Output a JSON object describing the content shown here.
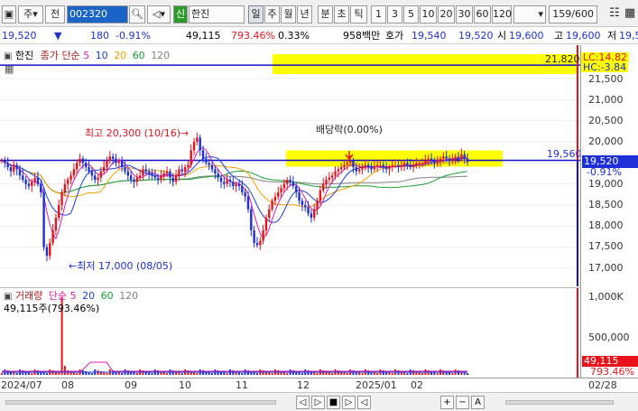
{
  "toolbar": {
    "menu_icon": "window-icon",
    "period_label": "주",
    "compare_label": "전",
    "code_value": "002320",
    "stock_name": "한진",
    "new_label": "신",
    "periods": [
      "일",
      "주",
      "월",
      "년",
      "분",
      "초",
      "틱"
    ],
    "minute_steps": [
      "1",
      "3",
      "5",
      "10",
      "20",
      "30",
      "60",
      "120"
    ],
    "count_value": "159/600"
  },
  "info": {
    "price": "19,520",
    "change": "180",
    "change_pct": "-0.91%",
    "volume": "49,115",
    "volume_ratio": "793.46%",
    "turnover_rate": "0.33%",
    "amount": "958백만",
    "ask_label": "호가",
    "ask_price": "19,540",
    "bid_price": "19,520",
    "open_label": "시",
    "open_price": "19,600",
    "high_label": "고",
    "high_price": "19,600",
    "low_label": "저",
    "low_price": "19,5"
  },
  "price_pane": {
    "name": "한진",
    "indicator": "종가 단순",
    "ma_periods": [
      "5",
      "10",
      "20",
      "60",
      "120"
    ],
    "ma_colors": [
      "#e01ab0",
      "#1a3fd9",
      "#f0a000",
      "#18a030",
      "#808080"
    ],
    "annotation_high": "최고 20,300 (10/16)",
    "annotation_low": "최저 17,000 (08/05)",
    "annotation_dividend": "배당락(0.00%)",
    "line_21820": "21,820",
    "line_19560": "19,560",
    "lc": "LC:14.82",
    "hc": "HC:-3.84",
    "current_price": "19,520",
    "current_pct": "-0.91%"
  },
  "vol_pane": {
    "label": "거래량",
    "indicator": "단순",
    "ma_periods": [
      "5",
      "20",
      "60",
      "120"
    ],
    "value_label": "49,115주(793.46%)",
    "current": "49,115",
    "current_pct": "793.46%"
  },
  "y_ticks": [
    "21,500",
    "21,000",
    "20,500",
    "20,000",
    "19,500",
    "19,000",
    "18,500",
    "18,000",
    "17,500",
    "17,000"
  ],
  "vol_ticks": [
    "1,000K",
    "500,000"
  ],
  "x_ticks": [
    "2024/07",
    "08",
    "09",
    "10",
    "11",
    "12",
    "2025/01",
    "02",
    "02/28"
  ],
  "bottom": {
    "buttons": [
      "◁",
      "▷",
      "■",
      "▷",
      "◁",
      "+",
      "−",
      "A"
    ]
  },
  "colors": {
    "up": "#e8121a",
    "down": "#1d2fd8",
    "highlight": "#ffff00",
    "line_blue": "#1010c8"
  },
  "chart_data": {
    "type": "candlestick",
    "x_range": [
      "2024-07",
      "2025-02-28"
    ],
    "ylim": [
      16800,
      22000
    ],
    "horizontal_lines": [
      21820,
      19560
    ],
    "closes": [
      19550,
      19500,
      19400,
      19300,
      19450,
      19350,
      19200,
      19100,
      19000,
      18950,
      19050,
      19150,
      19000,
      18800,
      17500,
      17300,
      17600,
      17900,
      18200,
      18500,
      18800,
      19000,
      19100,
      19200,
      19350,
      19500,
      19600,
      19500,
      19400,
      19300,
      19200,
      19100,
      19150,
      19300,
      19400,
      19550,
      19650,
      19600,
      19500,
      19550,
      19400,
      19300,
      19200,
      19100,
      19050,
      19150,
      19200,
      19350,
      19300,
      19250,
      19200,
      19150,
      19100,
      19200,
      19250,
      19300,
      19150,
      19050,
      19200,
      19350,
      19300,
      19400,
      19450,
      19800,
      20000,
      20100,
      19800,
      19600,
      19500,
      19450,
      19350,
      19250,
      19150,
      19050,
      19000,
      19100,
      19050,
      18950,
      19000,
      18950,
      18800,
      18700,
      18400,
      17900,
      17600,
      17550,
      17650,
      17900,
      18200,
      18400,
      18600,
      18700,
      18800,
      18900,
      19000,
      19100,
      19050,
      18950,
      18800,
      18600,
      18500,
      18450,
      18300,
      18200,
      18400,
      18600,
      18850,
      19000,
      19100,
      19150,
      19200,
      19300,
      19350,
      19400,
      19450,
      19500,
      19550,
      19400,
      19300,
      19350,
      19400,
      19450,
      19400,
      19350,
      19400,
      19450,
      19450,
      19400,
      19350,
      19400,
      19450,
      19450,
      19400,
      19450,
      19500,
      19450,
      19400,
      19450,
      19500,
      19500,
      19500,
      19550,
      19600,
      19550,
      19500,
      19550,
      19600,
      19650,
      19600,
      19550,
      19600,
      19650,
      19600,
      19700,
      19600,
      19520
    ]
  }
}
